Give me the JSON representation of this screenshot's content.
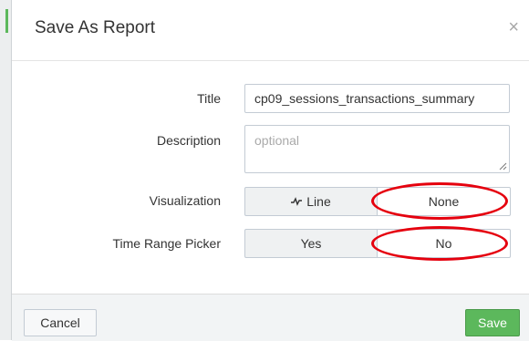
{
  "dialog": {
    "title": "Save As Report",
    "close_glyph": "×"
  },
  "form": {
    "title_label": "Title",
    "title_value": "cp09_sessions_transactions_summary",
    "description_label": "Description",
    "description_placeholder": "optional",
    "visualization_label": "Visualization",
    "visualization_options": [
      "Line",
      "None"
    ],
    "visualization_selected": "None",
    "time_range_label": "Time Range Picker",
    "time_range_options": [
      "Yes",
      "No"
    ],
    "time_range_selected": "No"
  },
  "footer": {
    "cancel_label": "Cancel",
    "save_label": "Save"
  },
  "colors": {
    "accent_green": "#5cb85c",
    "annotation_red": "#e5000e"
  },
  "icons": {
    "line_chart": "line-chart-icon",
    "close": "close-icon"
  }
}
